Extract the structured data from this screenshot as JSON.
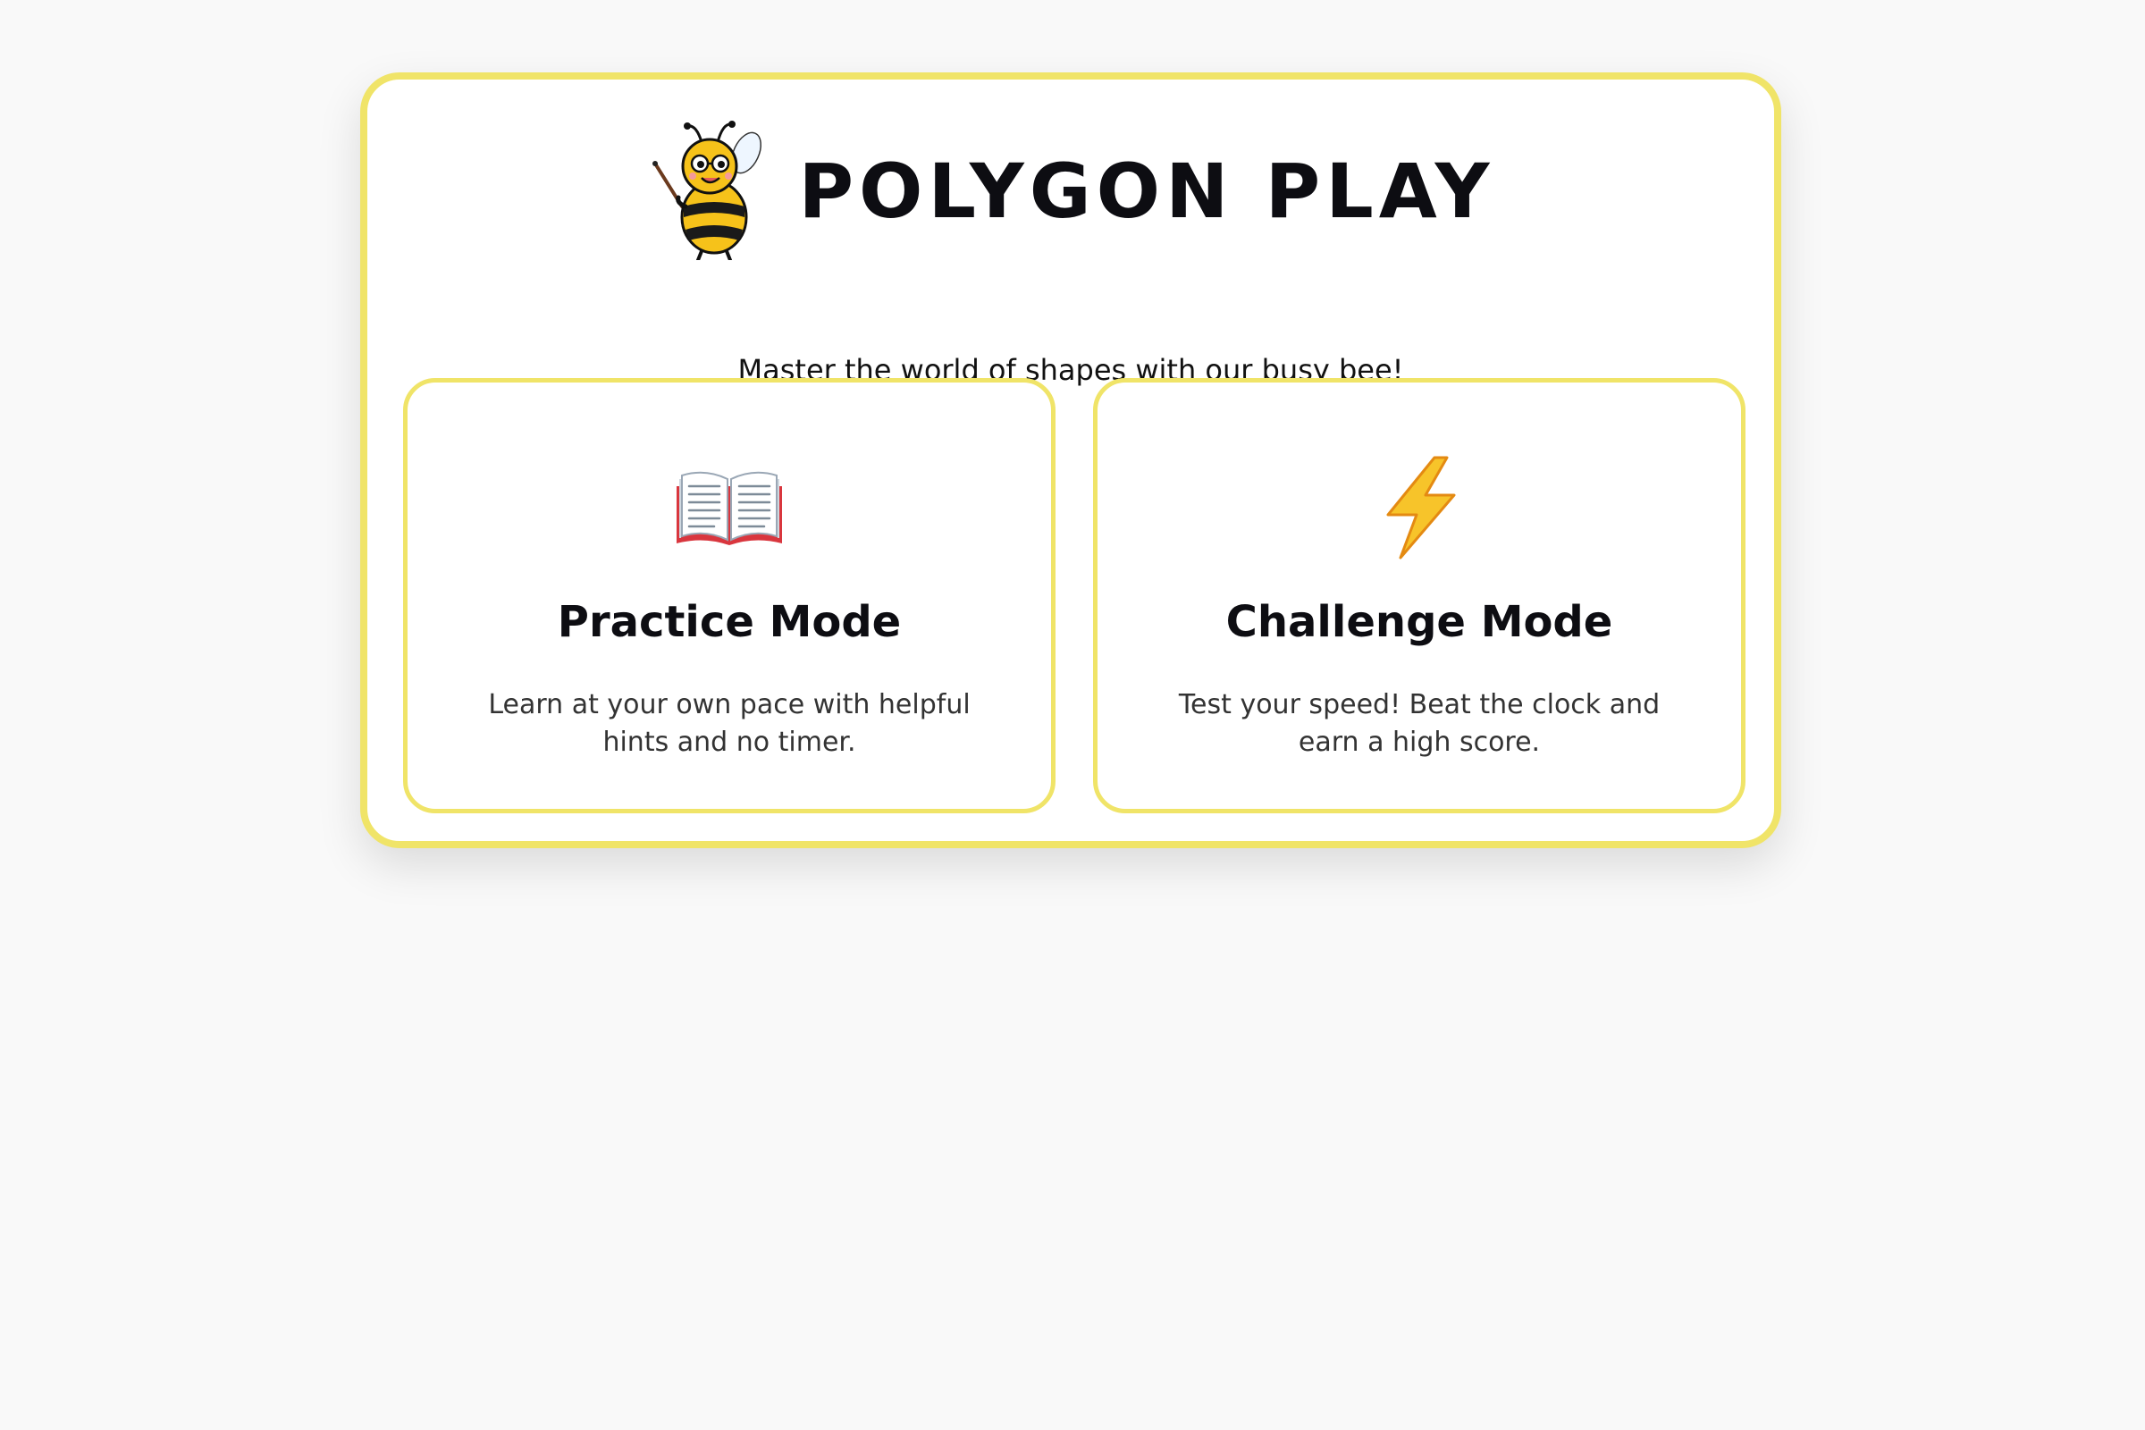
{
  "app": {
    "title": "POLYGON PLAY",
    "tagline": "Master the world of shapes with our busy bee!",
    "accent_color": "#f0e468"
  },
  "modes": [
    {
      "icon": "open-book-icon",
      "title": "Practice Mode",
      "description": "Learn at your own pace with helpful hints and no timer."
    },
    {
      "icon": "lightning-bolt-icon",
      "title": "Challenge Mode",
      "description": "Test your speed! Beat the clock and earn a high score."
    }
  ]
}
